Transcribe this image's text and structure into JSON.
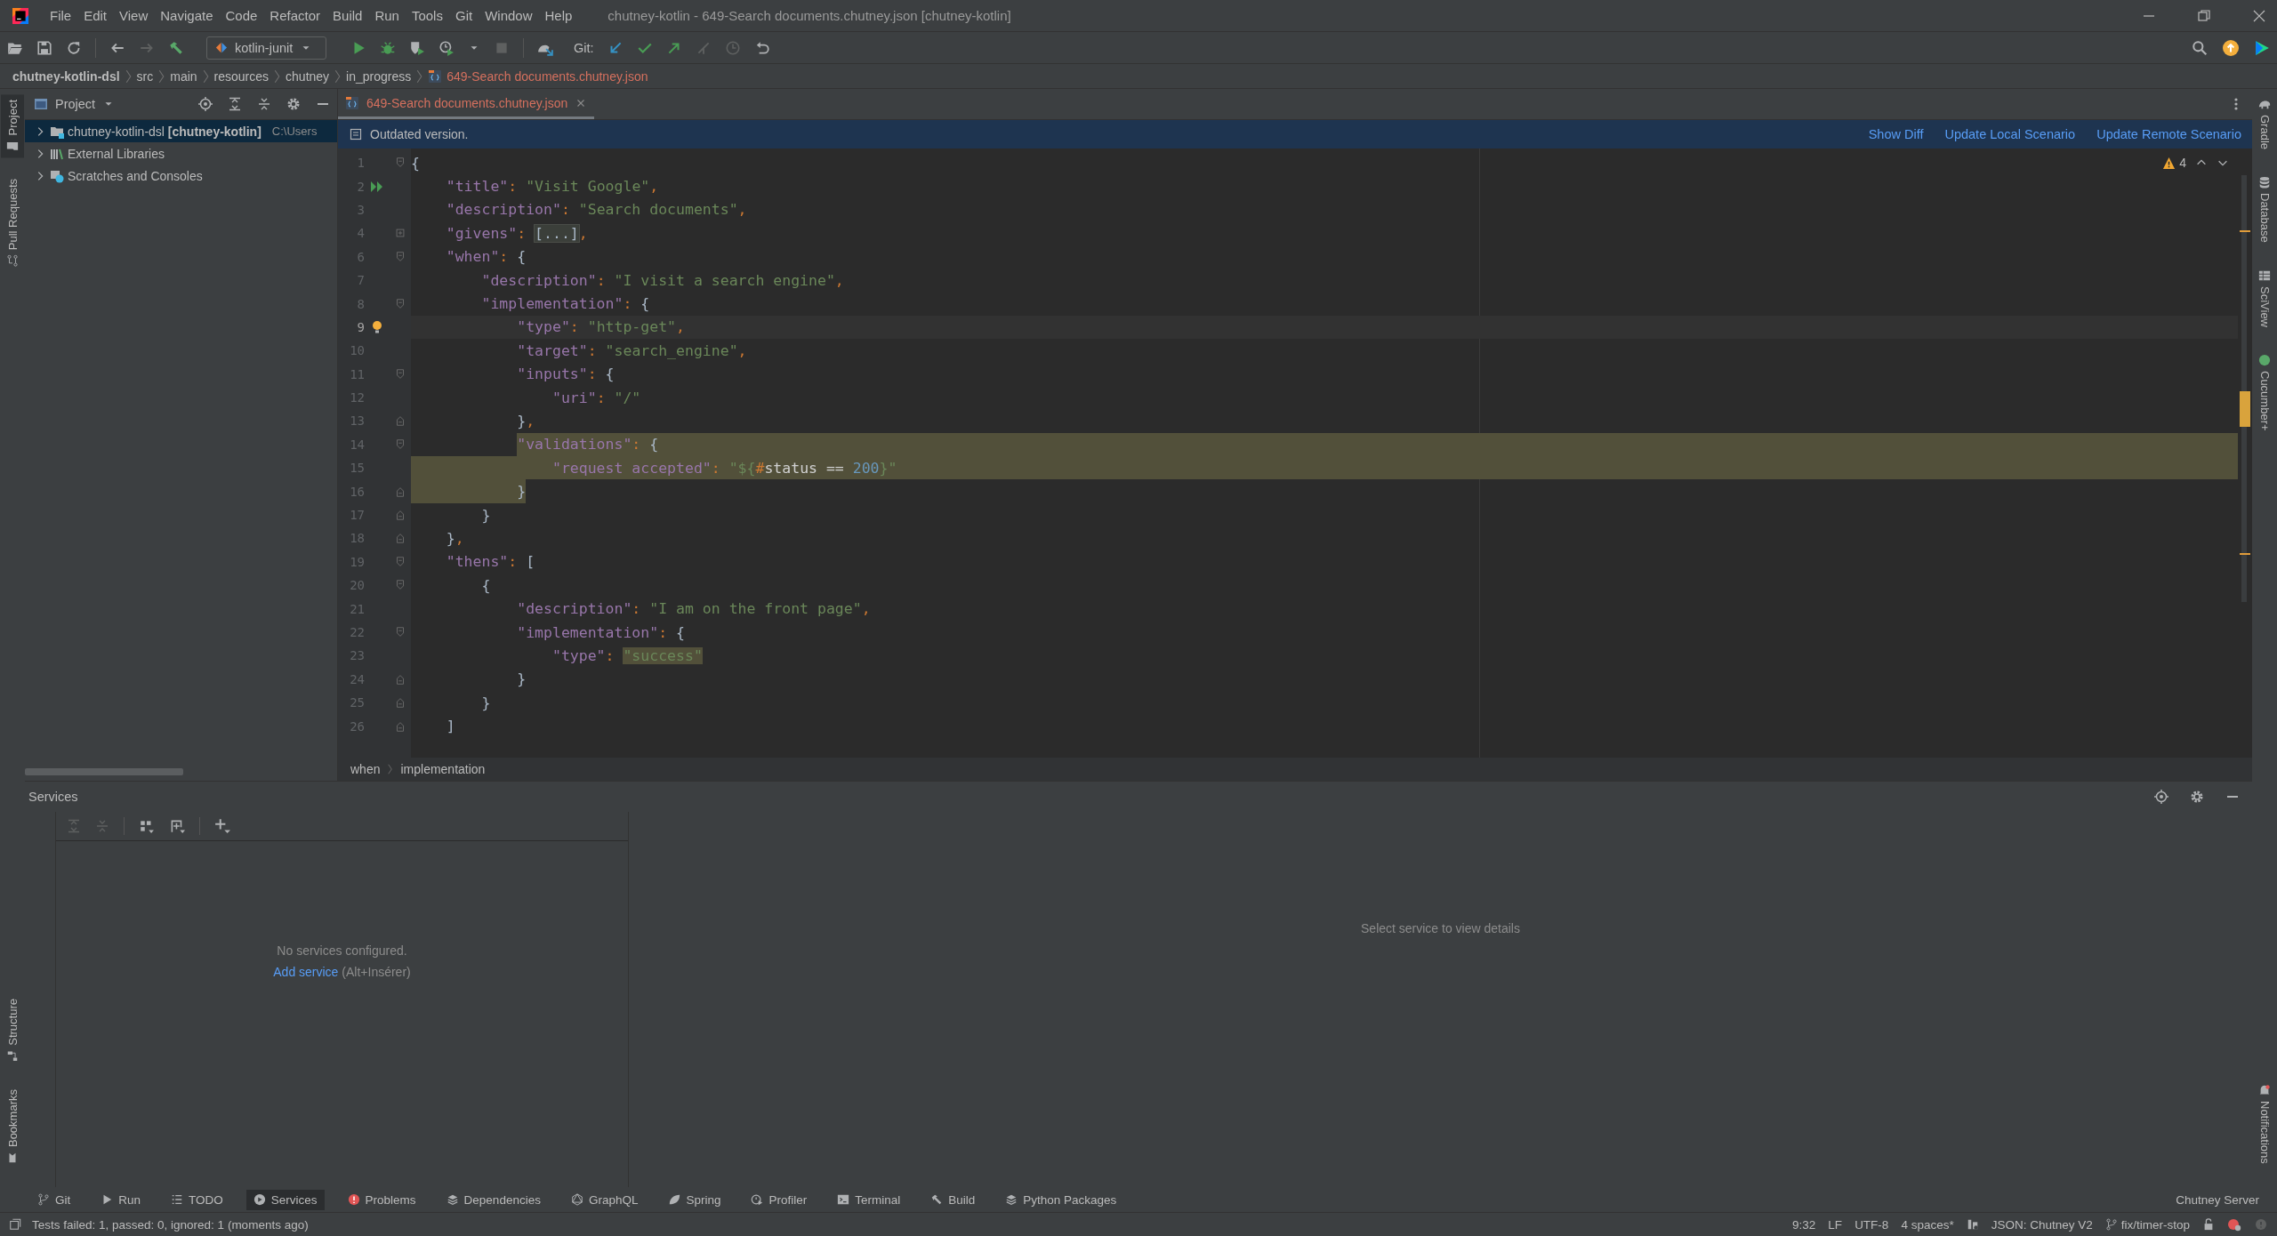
{
  "window": {
    "title": "chutney-kotlin - 649-Search documents.chutney.json [chutney-kotlin]",
    "menu": [
      "File",
      "Edit",
      "View",
      "Navigate",
      "Code",
      "Refactor",
      "Build",
      "Run",
      "Tools",
      "Git",
      "Window",
      "Help"
    ]
  },
  "toolbar": {
    "run_configuration": "kotlin-junit",
    "vcs_label": "Git:"
  },
  "nav_bar": {
    "crumbs": [
      "chutney-kotlin-dsl",
      "src",
      "main",
      "resources",
      "chutney",
      "in_progress"
    ],
    "file": "649-Search documents.chutney.json"
  },
  "left_stripe": {
    "top": [
      {
        "label": "Project",
        "selected": true
      },
      {
        "label": "Pull Requests",
        "selected": false
      }
    ],
    "bottom": [
      {
        "label": "Structure",
        "selected": false
      },
      {
        "label": "Bookmarks",
        "selected": false
      }
    ]
  },
  "right_stripe": {
    "top": [
      {
        "label": "Gradle"
      },
      {
        "label": "Database"
      },
      {
        "label": "SciView"
      },
      {
        "label": "Cucumber+"
      }
    ],
    "bottom": [
      {
        "label": "Notifications"
      }
    ]
  },
  "project_panel": {
    "title": "Project",
    "tree": [
      {
        "name": "chutney-kotlin-dsl **[chutney-kotlin]**",
        "path": "C:\\Users",
        "selected": true,
        "expanded": false
      },
      {
        "name": "External Libraries",
        "selected": false,
        "expanded": false
      },
      {
        "name": "Scratches and Consoles",
        "selected": false,
        "expanded": false
      }
    ]
  },
  "editor": {
    "tabs": [
      {
        "label": "649-Search documents.chutney.json",
        "selected": true
      }
    ],
    "banner": {
      "message": "Outdated version.",
      "actions": [
        "Show Diff",
        "Update Local Scenario",
        "Update Remote Scenario"
      ]
    },
    "inspections": {
      "warnings": "4"
    },
    "lines": [
      {
        "n": "1",
        "fold": {
          "kind": "start"
        },
        "current": false,
        "tokens": [
          {
            "kind": "b",
            "text": "{"
          }
        ]
      },
      {
        "n": "2",
        "gutter_icon": {
          "kind": "run"
        },
        "current": false,
        "tokens": [
          {
            "kind": "key",
            "text": "    \"title\""
          },
          {
            "kind": "p",
            "text": ": "
          },
          {
            "kind": "str",
            "text": "\"Visit Google\""
          },
          {
            "kind": "p",
            "text": ","
          }
        ]
      },
      {
        "n": "3",
        "current": false,
        "tokens": [
          {
            "kind": "key",
            "text": "    \"description\""
          },
          {
            "kind": "p",
            "text": ": "
          },
          {
            "kind": "str",
            "text": "\"Search documents\""
          },
          {
            "kind": "p",
            "text": ","
          }
        ]
      },
      {
        "n": "4",
        "fold": {
          "kind": "collapsed"
        },
        "current": false,
        "tokens": [
          {
            "kind": "key",
            "text": "    \"givens\""
          },
          {
            "kind": "p",
            "text": ": "
          },
          {
            "kind": "fold",
            "text": "[...]"
          },
          {
            "kind": "p",
            "text": ","
          }
        ]
      },
      {
        "n": "6",
        "fold": {
          "kind": "start"
        },
        "current": false,
        "tokens": [
          {
            "kind": "key",
            "text": "    \"when\""
          },
          {
            "kind": "p",
            "text": ": "
          },
          {
            "kind": "b",
            "text": "{"
          }
        ]
      },
      {
        "n": "7",
        "current": false,
        "tokens": [
          {
            "kind": "key",
            "text": "        \"description\""
          },
          {
            "kind": "p",
            "text": ": "
          },
          {
            "kind": "str",
            "text": "\"I visit a search engine\""
          },
          {
            "kind": "p",
            "text": ","
          }
        ]
      },
      {
        "n": "8",
        "fold": {
          "kind": "start"
        },
        "current": false,
        "tokens": [
          {
            "kind": "key",
            "text": "        \"implementation\""
          },
          {
            "kind": "p",
            "text": ": "
          },
          {
            "kind": "b",
            "text": "{"
          }
        ]
      },
      {
        "n": "9",
        "gutter_icon": {
          "kind": "bulb"
        },
        "current": true,
        "tokens": [
          {
            "kind": "key",
            "text": "            \"type\""
          },
          {
            "kind": "p",
            "text": ": "
          },
          {
            "kind": "str",
            "text": "\"http-get\""
          },
          {
            "kind": "p",
            "text": ","
          }
        ]
      },
      {
        "n": "10",
        "current": false,
        "tokens": [
          {
            "kind": "key",
            "text": "            \"target\""
          },
          {
            "kind": "p",
            "text": ": "
          },
          {
            "kind": "str",
            "text": "\"search_engine\""
          },
          {
            "kind": "p",
            "text": ","
          }
        ]
      },
      {
        "n": "11",
        "fold": {
          "kind": "start"
        },
        "current": false,
        "tokens": [
          {
            "kind": "key",
            "text": "            \"inputs\""
          },
          {
            "kind": "p",
            "text": ": "
          },
          {
            "kind": "b",
            "text": "{"
          }
        ]
      },
      {
        "n": "12",
        "current": false,
        "tokens": [
          {
            "kind": "key",
            "text": "                \"uri\""
          },
          {
            "kind": "p",
            "text": ": "
          },
          {
            "kind": "str",
            "text": "\"/\""
          }
        ]
      },
      {
        "n": "13",
        "fold": {
          "kind": "end"
        },
        "current": false,
        "tokens": [
          {
            "kind": "b",
            "text": "            }"
          },
          {
            "kind": "p",
            "text": ","
          }
        ]
      },
      {
        "n": "14",
        "fold": {
          "kind": "start"
        },
        "selection": {
          "kind": "tail"
        },
        "current": false,
        "tokens": [
          {
            "kind": "key",
            "text": "            \"validations\""
          },
          {
            "kind": "p",
            "text": ": "
          },
          {
            "kind": "b",
            "text": "{"
          }
        ]
      },
      {
        "n": "15",
        "selection": {
          "kind": "whole"
        },
        "current": false,
        "tokens": [
          {
            "kind": "key",
            "text": "                \"request accepted\""
          },
          {
            "kind": "p",
            "text": ": "
          },
          {
            "kind": "str",
            "text": "\"${"
          },
          {
            "kind": "hash",
            "text": "#"
          },
          {
            "kind": "id",
            "text": "status =="
          },
          {
            "kind": "num",
            "text": " 200"
          },
          {
            "kind": "str",
            "text": "}\""
          }
        ]
      },
      {
        "n": "16",
        "fold": {
          "kind": "end"
        },
        "selection": {
          "kind": "head"
        },
        "current": false,
        "tokens": [
          {
            "kind": "b",
            "text": "            }"
          }
        ]
      },
      {
        "n": "17",
        "fold": {
          "kind": "end"
        },
        "current": false,
        "tokens": [
          {
            "kind": "b",
            "text": "        }"
          }
        ]
      },
      {
        "n": "18",
        "fold": {
          "kind": "end"
        },
        "current": false,
        "tokens": [
          {
            "kind": "b",
            "text": "    }"
          },
          {
            "kind": "p",
            "text": ","
          }
        ]
      },
      {
        "n": "19",
        "fold": {
          "kind": "start"
        },
        "current": false,
        "tokens": [
          {
            "kind": "key",
            "text": "    \"thens\""
          },
          {
            "kind": "p",
            "text": ": "
          },
          {
            "kind": "b",
            "text": "["
          }
        ]
      },
      {
        "n": "20",
        "fold": {
          "kind": "start"
        },
        "current": false,
        "tokens": [
          {
            "kind": "b",
            "text": "        {"
          }
        ]
      },
      {
        "n": "21",
        "current": false,
        "tokens": [
          {
            "kind": "key",
            "text": "            \"description\""
          },
          {
            "kind": "p",
            "text": ": "
          },
          {
            "kind": "str",
            "text": "\"I am on the front page\""
          },
          {
            "kind": "p",
            "text": ","
          }
        ]
      },
      {
        "n": "22",
        "fold": {
          "kind": "start"
        },
        "current": false,
        "tokens": [
          {
            "kind": "key",
            "text": "            \"implementation\""
          },
          {
            "kind": "p",
            "text": ": "
          },
          {
            "kind": "b",
            "text": "{"
          }
        ]
      },
      {
        "n": "23",
        "current": false,
        "tokens": [
          {
            "kind": "key",
            "text": "                \"type\""
          },
          {
            "kind": "p",
            "text": ": "
          },
          {
            "kind": "match",
            "text": "\"success\""
          }
        ]
      },
      {
        "n": "24",
        "fold": {
          "kind": "end"
        },
        "current": false,
        "tokens": [
          {
            "kind": "b",
            "text": "            }"
          }
        ]
      },
      {
        "n": "25",
        "fold": {
          "kind": "end"
        },
        "current": false,
        "tokens": [
          {
            "kind": "b",
            "text": "        }"
          }
        ]
      },
      {
        "n": "26",
        "fold": {
          "kind": "end"
        },
        "current": false,
        "tokens": [
          {
            "kind": "b",
            "text": "    ]"
          }
        ]
      }
    ],
    "breadcrumbs": [
      "when",
      "implementation"
    ]
  },
  "services": {
    "title": "Services",
    "empty_message": "No services configured.",
    "add_link": "Add service",
    "shortcut": "(Alt+Insérer)",
    "detail_hint": "Select service to view details"
  },
  "tool_windows": {
    "items": [
      {
        "label": "Git",
        "selected": false
      },
      {
        "label": "Run",
        "selected": false
      },
      {
        "label": "TODO",
        "selected": false
      },
      {
        "label": "Services",
        "selected": true
      },
      {
        "label": "Problems",
        "selected": false
      },
      {
        "label": "Dependencies",
        "selected": false
      },
      {
        "label": "GraphQL",
        "selected": false
      },
      {
        "label": "Spring",
        "selected": false
      },
      {
        "label": "Profiler",
        "selected": false
      },
      {
        "label": "Terminal",
        "selected": false
      },
      {
        "label": "Build",
        "selected": false
      },
      {
        "label": "Python Packages",
        "selected": false
      }
    ],
    "right_label": "Chutney Server"
  },
  "status_bar": {
    "message": "Tests failed: 1, passed: 0, ignored: 1 (moments ago)",
    "position": "9:32",
    "line_ending": "LF",
    "encoding": "UTF-8",
    "indent": "4 spaces*",
    "schema": "JSON: Chutney V2",
    "branch": "fix/timer-stop"
  }
}
